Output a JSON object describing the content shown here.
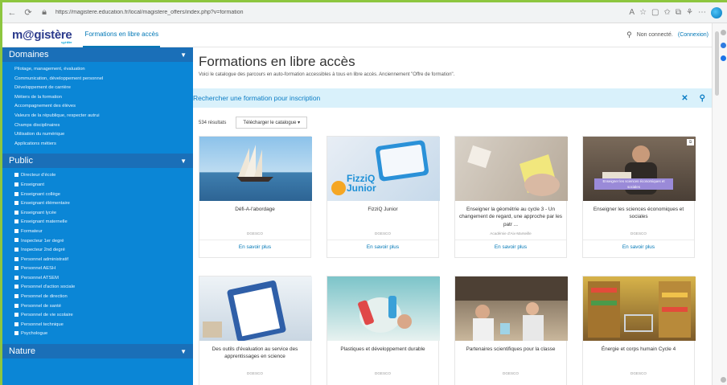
{
  "browser": {
    "url": "https://magistere.education.fr/local/magistere_offers/index.php?v=formation"
  },
  "header": {
    "logo_text": "m@gistère",
    "logo_subtitle": "sgphilliter",
    "tab_label": "Formations en libre accès",
    "status_text": "Non connecté.",
    "login_label": "(Connexion)"
  },
  "sidebar": {
    "domaines": {
      "title": "Domaines",
      "items": [
        "Pilotage, management, évaluation",
        "Communication, développement personnel",
        "Développement de carrière",
        "Métiers de la formation",
        "Accompagnement des élèves",
        "Valeurs de la république, respecter autrui",
        "Champs disciplinaires",
        "Utilisation du numérique",
        "Applications métiers"
      ]
    },
    "public": {
      "title": "Public",
      "items": [
        "Directeur d'école",
        "Enseignant",
        "Enseignant collège",
        "Enseignant élémentaire",
        "Enseignant lycée",
        "Enseignant maternelle",
        "Formateur",
        "Inspecteur 1er degré",
        "Inspecteur 2nd degré",
        "Personnel administratif",
        "Personnel AESH",
        "Personnel ATSEM",
        "Personnel d'action sociale",
        "Personnel de direction",
        "Personnel de santé",
        "Personnel de vie scolaire",
        "Personnel technique",
        "Psychologue"
      ]
    },
    "nature": {
      "title": "Nature"
    }
  },
  "main": {
    "title": "Formations en libre accès",
    "description": "Voici le catalogue des parcours en auto-formation accessibles à tous en libre accès. Anciennement \"Offre de formation\".",
    "search_label": "Rechercher une formation pour inscription",
    "result_count": "534 résultats",
    "download_label": "Télécharger le catalogue ▾",
    "cards": [
      {
        "title": "Défi-A-l'abordage",
        "org": "DGESCO",
        "link": "En savoir plus",
        "image": "sailboat"
      },
      {
        "title": "FizziQ Junior",
        "org": "DGESCO",
        "link": "En savoir plus",
        "image": "fizziq",
        "image_text_1": "FizziQ",
        "image_text_2": "Junior"
      },
      {
        "title": "Enseigner la géométrie au cycle 3 - Un changement de regard, une approche par les patr ...",
        "org": "Académie d'Aix-Marseille",
        "link": "En savoir plus",
        "image": "geometry"
      },
      {
        "title": "Enseigner les sciences économiques et sociales",
        "org": "DGESCO",
        "link": "En savoir plus",
        "image": "economics",
        "image_banner": "Enseigner les sciences économiques et sociales"
      },
      {
        "title": "Des outils d'évaluation au service des apprentissages en science",
        "org": "DGESCO",
        "link": "",
        "image": "clipboard"
      },
      {
        "title": "Plastiques et développement durable",
        "org": "DGESCO",
        "link": "",
        "image": "plastic"
      },
      {
        "title": "Partenaires scientifiques pour la classe",
        "org": "DGESCO",
        "link": "",
        "image": "lab"
      },
      {
        "title": "Énergie et corps humain Cycle 4",
        "org": "DGESCO",
        "link": "",
        "image": "shop"
      }
    ]
  },
  "colors": {
    "frame": "#8dc63f",
    "sidebar": "#0b86d6",
    "accent": "#0077b6",
    "search_bg": "#d9f1fb"
  }
}
